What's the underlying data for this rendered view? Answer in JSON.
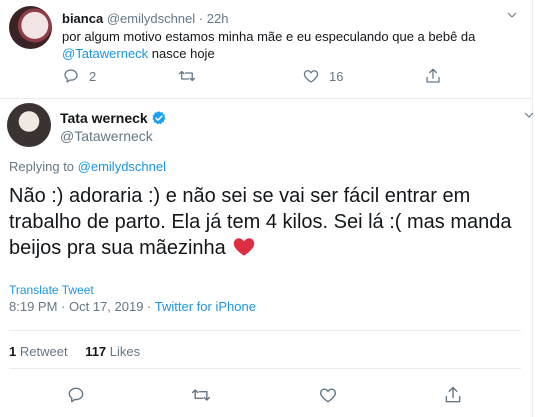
{
  "reply_tweet": {
    "author_name": "bianca",
    "author_handle": "@emilydschnel",
    "separator": "·",
    "time": "22h",
    "text_main": "por algum motivo estamos minha mãe e eu especulando que a bebê da",
    "mention": "@Tatawerneck",
    "text_tail": " nasce hoje",
    "reply_count": "2",
    "retweet_count": "",
    "like_count": "16"
  },
  "main_tweet": {
    "author_name": "Tata werneck",
    "author_handle": "@Tatawerneck",
    "replying_label": "Replying to ",
    "replying_to": "@emilydschnel",
    "text": "Não :) adoraria :) e não sei se vai ser fácil entrar em trabalho de parto. Ela já tem 4 kilos. Sei lá :( mas manda beijos pra sua mãezinha",
    "translate_label": "Translate Tweet",
    "time": "8:19 PM",
    "date": "Oct 17, 2019",
    "meta_separator": " · ",
    "source": "Twitter for iPhone",
    "retweets_count": "1",
    "retweets_label": "Retweet",
    "likes_count": "117",
    "likes_label": "Likes"
  },
  "colors": {
    "link": "#1b95e0",
    "muted": "#657786",
    "verified": "#1da1f2",
    "heart": "#e0245e"
  },
  "icons": [
    "chevron-down-icon",
    "reply-icon",
    "retweet-icon",
    "like-icon",
    "share-icon",
    "verified-badge-icon",
    "red-heart-emoji"
  ]
}
